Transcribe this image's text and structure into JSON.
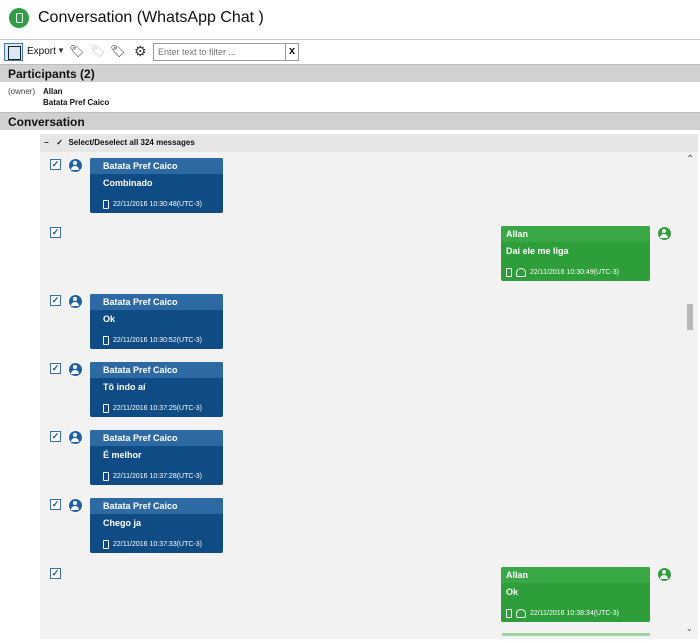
{
  "window": {
    "title": "Conversation (WhatsApp Chat )"
  },
  "toolbar": {
    "export_label": "Export",
    "filter_placeholder": "Enter text to filter ...",
    "clear_label": "x",
    "icons": [
      "layout-toggle-icon",
      "tag-add-icon",
      "tag-remove-icon",
      "tag-icon",
      "gear-icon"
    ]
  },
  "participants": {
    "header": "Participants (2)",
    "owner_label": "(owner)",
    "names": [
      "Allan",
      "Batata Pref Caico"
    ]
  },
  "conversation": {
    "header": "Conversation",
    "select_all": "Select/Deselect all 324 messages",
    "messages": [
      {
        "direction": "in",
        "sender": "Batata Pref Caico",
        "text": "Combinado",
        "timestamp": "22/11/2016 10:30:48(UTC-3)",
        "checked": true
      },
      {
        "direction": "out",
        "sender": "Allan",
        "text": "Daí ele me liga",
        "timestamp": "22/11/2016 10:30:49(UTC-3)",
        "checked": true
      },
      {
        "direction": "in",
        "sender": "Batata Pref Caico",
        "text": "Ok",
        "timestamp": "22/11/2016 10:30:52(UTC-3)",
        "checked": true
      },
      {
        "direction": "in",
        "sender": "Batata Pref Caico",
        "text": "Tô indo aí",
        "timestamp": "22/11/2016 10:37:25(UTC-3)",
        "checked": true
      },
      {
        "direction": "in",
        "sender": "Batata Pref Caico",
        "text": "É melhor",
        "timestamp": "22/11/2016 10:37:28(UTC-3)",
        "checked": true
      },
      {
        "direction": "in",
        "sender": "Batata Pref Caico",
        "text": "Chego ja",
        "timestamp": "22/11/2016 10:37:33(UTC-3)",
        "checked": true
      },
      {
        "direction": "out",
        "sender": "Allan",
        "text": "Ok",
        "timestamp": "22/11/2016 10:38:34(UTC-3)",
        "checked": true
      }
    ]
  },
  "colors": {
    "incoming_bubble": "#0f4c85",
    "incoming_header": "#2d6aa3",
    "outgoing_bubble": "#2e9e3b",
    "app_icon": "#2f9e44"
  }
}
